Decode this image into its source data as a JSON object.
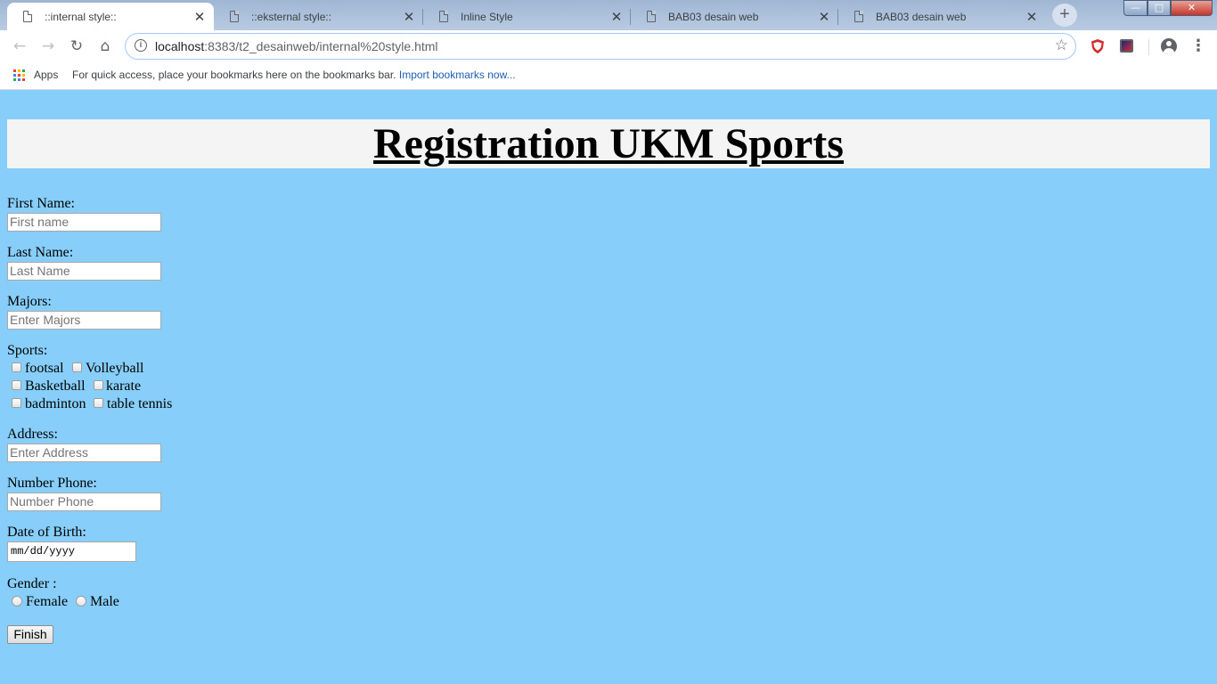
{
  "browser": {
    "tabs": [
      {
        "title": "::internal style::",
        "active": true
      },
      {
        "title": "::eksternal style::",
        "active": false
      },
      {
        "title": "Inline Style",
        "active": false
      },
      {
        "title": "BAB03 desain web",
        "active": false
      },
      {
        "title": "BAB03 desain web",
        "active": false
      }
    ],
    "tab_close_glyph": "✕",
    "new_tab_glyph": "+",
    "url_host": "localhost",
    "url_rest": ":8383/t2_desainweb/internal%20style.html",
    "bookmarks_bar": {
      "apps_label": "Apps",
      "hint": "For quick access, place your bookmarks here on the bookmarks bar.",
      "import_link": "Import bookmarks now..."
    },
    "colors": {
      "accent_blue": "#1a5fb4",
      "shield_red": "#d32f2f"
    }
  },
  "page": {
    "background": "#87cefa",
    "heading": "Registration UKM Sports",
    "form": {
      "first_name_label": "First Name:",
      "first_name_placeholder": "First name",
      "last_name_label": "Last Name:",
      "last_name_placeholder": "Last Name",
      "majors_label": "Majors:",
      "majors_placeholder": "Enter Majors",
      "sports_label": "Sports:",
      "sports": [
        "footsal",
        "Volleyball",
        "Basketball",
        "karate",
        "badminton",
        "table tennis"
      ],
      "address_label": "Address:",
      "address_placeholder": "Enter Address",
      "phone_label": "Number Phone:",
      "phone_placeholder": "Number Phone",
      "dob_label": "Date of Birth:",
      "dob_placeholder": "mm/dd/yyyy",
      "gender_label": "Gender :",
      "genders": [
        "Female",
        "Male"
      ],
      "submit_label": "Finish"
    }
  }
}
